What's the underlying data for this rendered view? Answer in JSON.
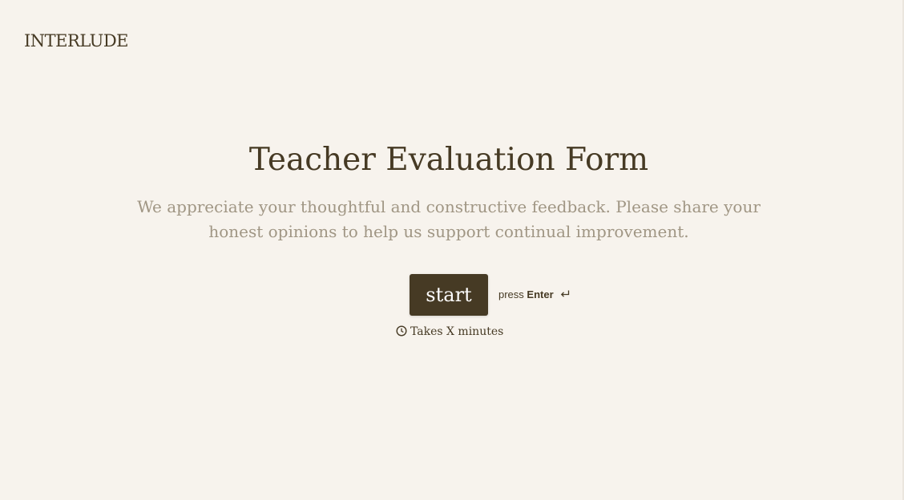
{
  "brand": {
    "logo_text": "INTERLUDE"
  },
  "form": {
    "title": "Teacher Evaluation Form",
    "description": "We appreciate your thoughtful and constructive feedback. Please share your honest opinions to help us support continual improvement.",
    "start_label": "start",
    "hint_prefix": "press",
    "hint_key": "Enter",
    "duration_text": "Takes X minutes"
  },
  "icons": {
    "enter": "enter-return-icon",
    "clock": "clock-icon"
  },
  "colors": {
    "background": "#f7f3ed",
    "primary": "#463a24",
    "muted_text": "#a09684",
    "button_text": "#ffffff"
  }
}
